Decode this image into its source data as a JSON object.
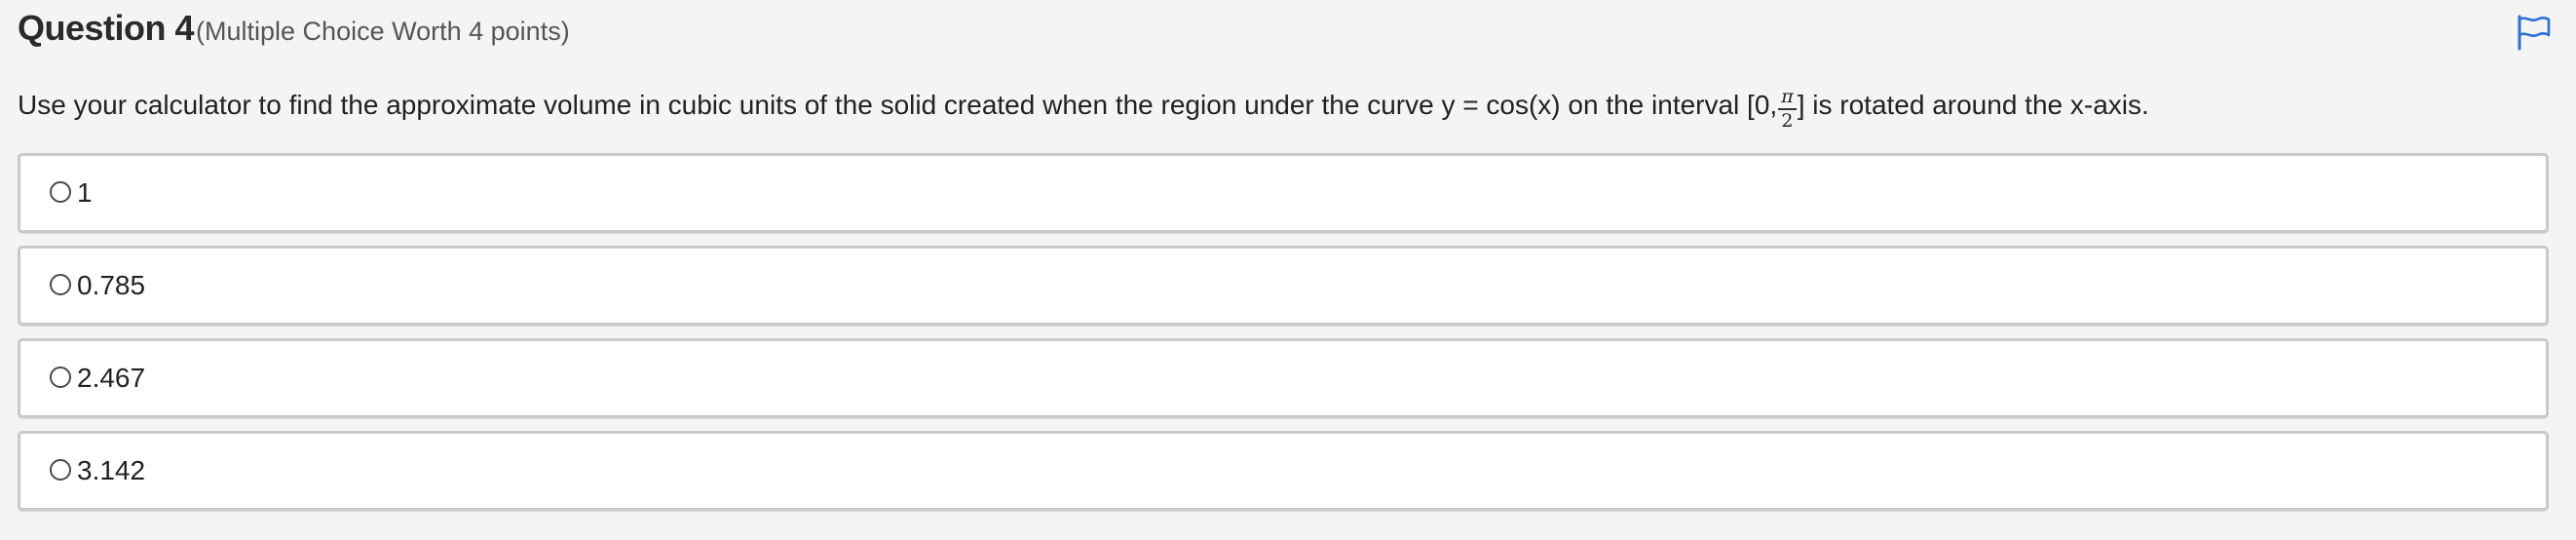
{
  "question": {
    "title": "Question 4",
    "meta": "(Multiple Choice Worth 4 points)",
    "prompt_before": "Use your calculator to find the approximate volume in cubic units of the solid created when the region under the curve y = cos(x) on the interval [0,",
    "fraction_numerator": "π",
    "fraction_denominator": "2",
    "prompt_after": "] is rotated around the x-axis."
  },
  "flag": {
    "icon": "flag-icon",
    "color": "#2f6fd1"
  },
  "choices": [
    {
      "label": "1",
      "selected": false
    },
    {
      "label": "0.785",
      "selected": false
    },
    {
      "label": "2.467",
      "selected": false
    },
    {
      "label": "3.142",
      "selected": false
    }
  ]
}
